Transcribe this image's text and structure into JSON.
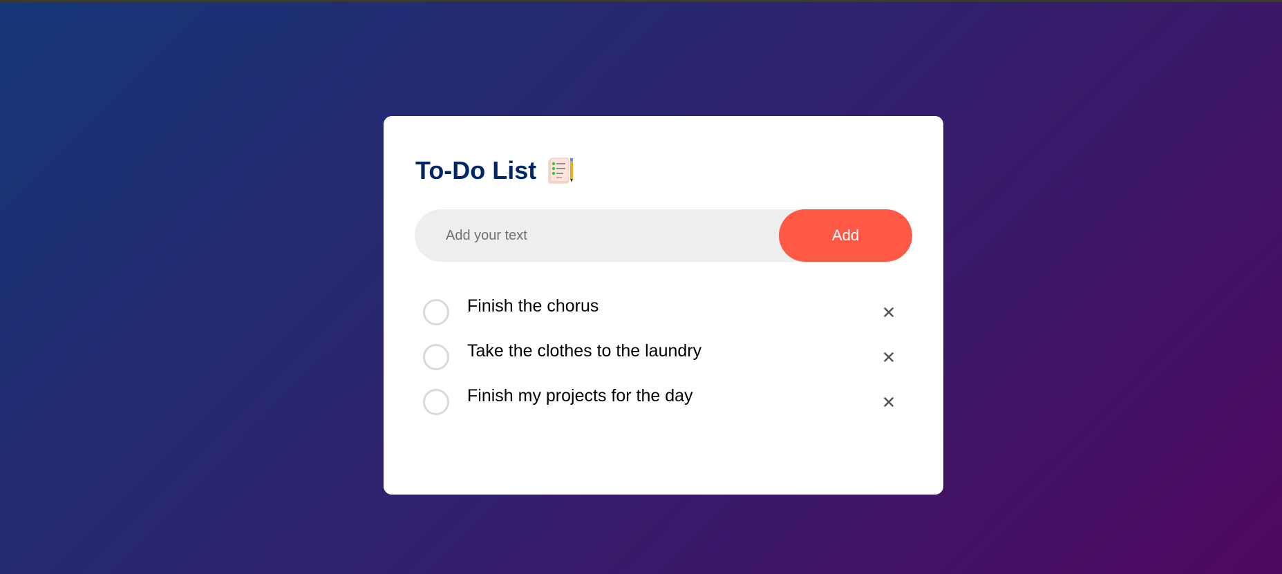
{
  "app": {
    "title": "To-Do List",
    "title_icon": "checklist-notepad-pencil-icon"
  },
  "input": {
    "placeholder": "Add your text",
    "value": "",
    "add_label": "Add"
  },
  "colors": {
    "title": "#002765",
    "add_button": "#ff5945",
    "input_bg": "#edeef0",
    "gradient_start": "#153677",
    "gradient_end": "#4e085f"
  },
  "tasks": [
    {
      "text": "Finish the chorus",
      "checked": false,
      "delete_icon": "close-icon"
    },
    {
      "text": "Take the clothes to the laundry",
      "checked": false,
      "delete_icon": "close-icon"
    },
    {
      "text": "Finish my projects for the day",
      "checked": false,
      "delete_icon": "close-icon"
    }
  ]
}
